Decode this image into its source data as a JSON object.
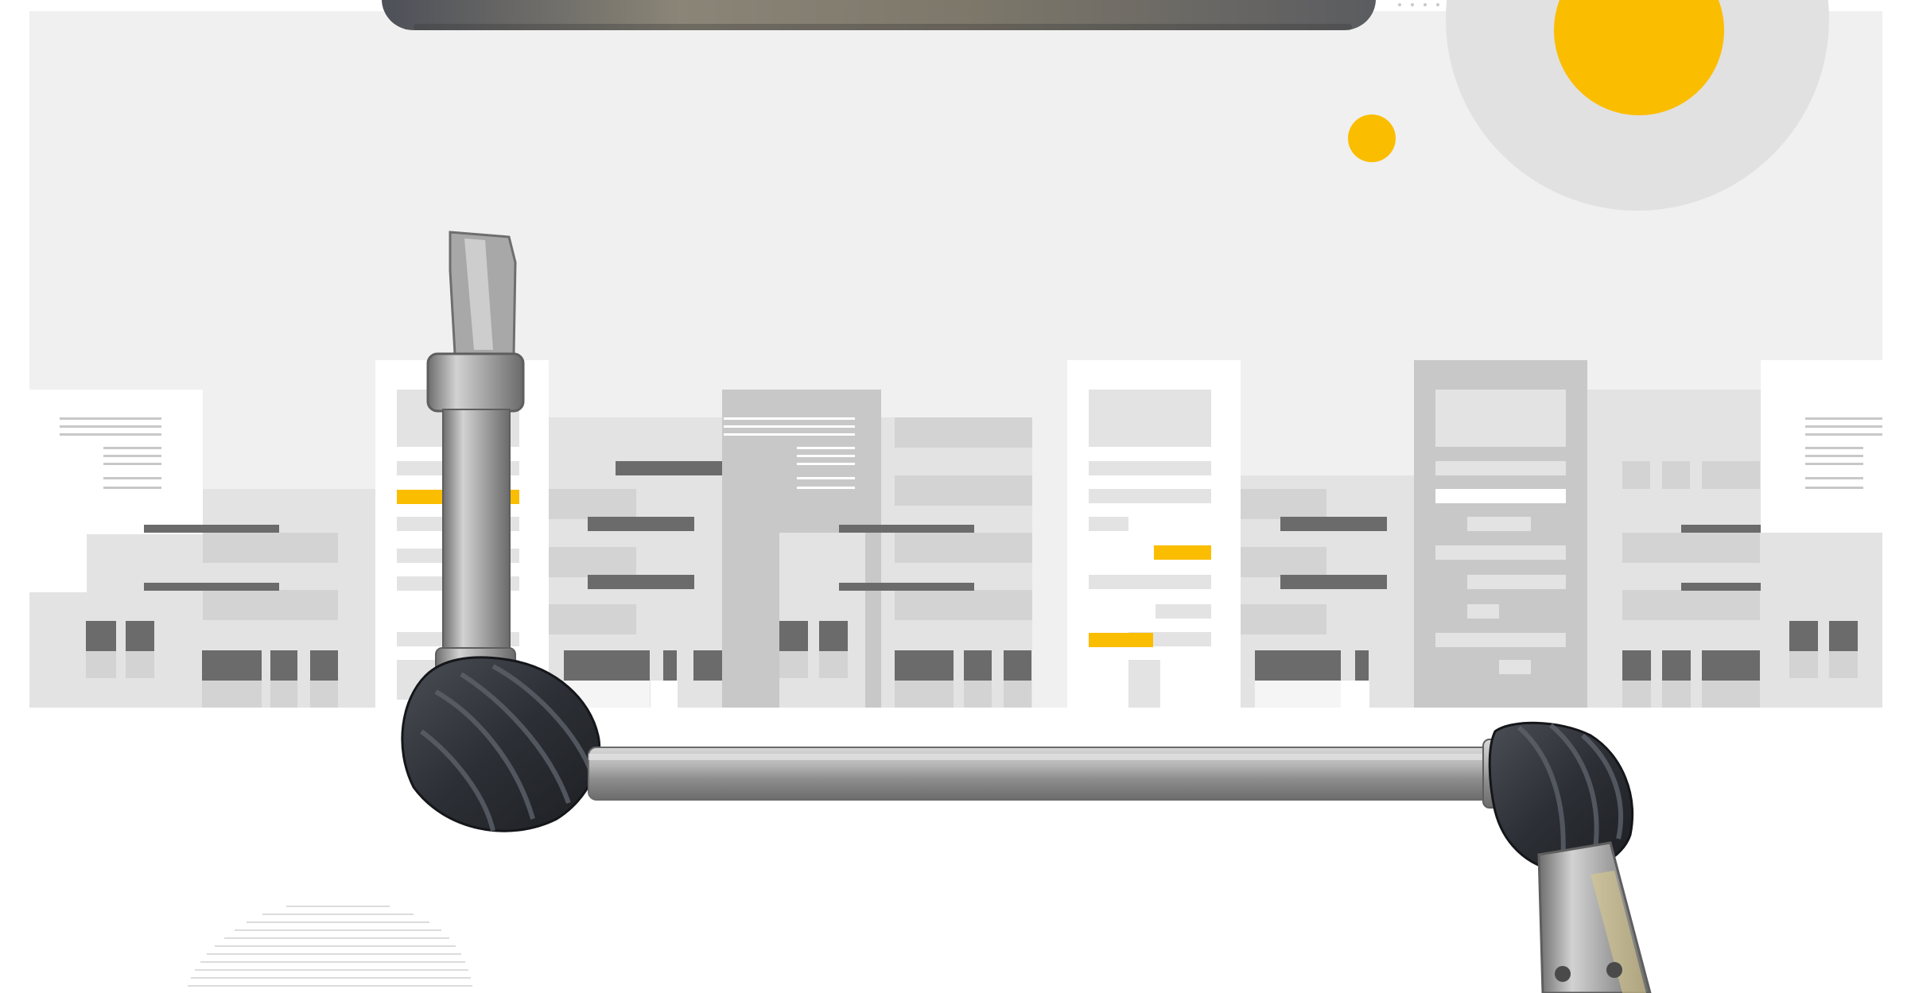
{
  "scene": {
    "subject": "steering-shaft-assembly",
    "colors": {
      "background": "#ffffff",
      "panel": "#f0f0f0",
      "building_light": "#e3e3e3",
      "building_mid": "#d2d2d2",
      "building_dark": "#c6c6c6",
      "window_dark": "#6b6b6b",
      "accent_yellow": "#fbbd00",
      "metal": "#9a9a9a",
      "rubber_boot": "#2f3238"
    }
  }
}
